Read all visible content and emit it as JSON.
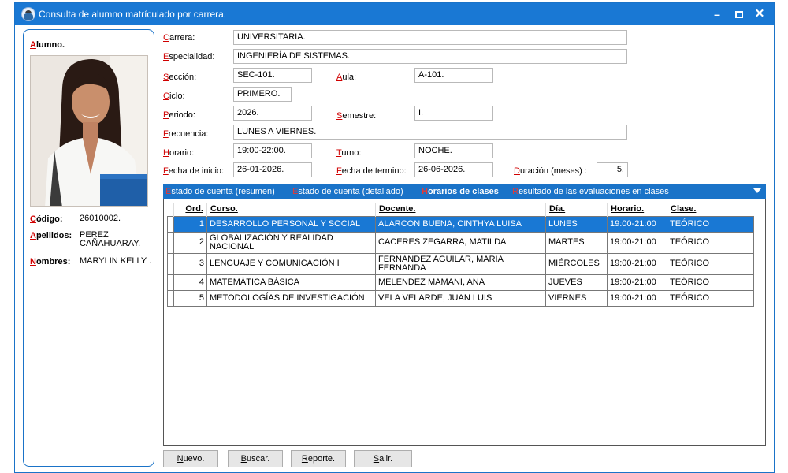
{
  "window": {
    "title": "Consulta de alumno matrículado por carrera.",
    "controls": {
      "minimize": "–",
      "close": "✕"
    }
  },
  "student": {
    "section_label": "Alumno.",
    "codigo_label": "Código:",
    "codigo": "26010002.",
    "apellidos_label": "Apellidos:",
    "apellidos": "PEREZ CAÑAHUARAY.",
    "nombres_label": "Nombres:",
    "nombres": "MARYLIN KELLY ."
  },
  "form": {
    "carrera": {
      "label": "Carrera:",
      "value": "UNIVERSITARIA."
    },
    "especialidad": {
      "label": "Especialidad:",
      "value": "INGENIERÍA DE SISTEMAS."
    },
    "seccion": {
      "label": "Sección:",
      "value": "SEC-101."
    },
    "aula": {
      "label": "Aula:",
      "value": "A-101."
    },
    "ciclo": {
      "label": "Ciclo:",
      "value": "PRIMERO."
    },
    "periodo": {
      "label": "Periodo:",
      "value": "2026."
    },
    "semestre": {
      "label": "Semestre:",
      "value": "I."
    },
    "frecuencia": {
      "label": "Frecuencia:",
      "value": "LUNES A VIERNES."
    },
    "horario": {
      "label": "Horario:",
      "value": "19:00-22:00."
    },
    "turno": {
      "label": "Turno:",
      "value": "NOCHE."
    },
    "fecha_inicio": {
      "label": "Fecha de inicio:",
      "value": "26-01-2026."
    },
    "fecha_termino": {
      "label": "Fecha de termino:",
      "value": "26-06-2026."
    },
    "duracion": {
      "label": "Duración (meses) :",
      "value": "5."
    }
  },
  "tabs": [
    {
      "hk": "E",
      "rest": "stado de cuenta (resumen)"
    },
    {
      "hk": "E",
      "rest": "stado de cuenta (detallado)"
    },
    {
      "hk": "H",
      "rest": "orarios de clases"
    },
    {
      "hk": "R",
      "rest": "esultado de las evaluaciones en clases"
    }
  ],
  "grid": {
    "columns": [
      "Ord.",
      "Curso.",
      "Docente.",
      "Día.",
      "Horario.",
      "Clase."
    ],
    "rows": [
      {
        "ord": "1",
        "curso": "DESARROLLO PERSONAL Y SOCIAL",
        "docente": "ALARCON BUENA, CINTHYA LUISA",
        "dia": "LUNES",
        "horario": "19:00-21:00",
        "clase": "TEÓRICO"
      },
      {
        "ord": "2",
        "curso": "GLOBALIZACIÓN Y REALIDAD NACIONAL",
        "docente": "CACERES ZEGARRA, MATILDA",
        "dia": "MARTES",
        "horario": "19:00-21:00",
        "clase": "TEÓRICO"
      },
      {
        "ord": "3",
        "curso": "LENGUAJE Y COMUNICACIÓN I",
        "docente": "FERNANDEZ AGUILAR, MARIA FERNANDA",
        "dia": "MIÉRCOLES",
        "horario": "19:00-21:00",
        "clase": "TEÓRICO"
      },
      {
        "ord": "4",
        "curso": "MATEMÁTICA BÁSICA",
        "docente": "MELENDEZ MAMANI, ANA",
        "dia": "JUEVES",
        "horario": "19:00-21:00",
        "clase": "TEÓRICO"
      },
      {
        "ord": "5",
        "curso": "METODOLOGÍAS DE INVESTIGACIÓN",
        "docente": "VELA VELARDE, JUAN LUIS",
        "dia": "VIERNES",
        "horario": "19:00-21:00",
        "clase": "TEÓRICO"
      }
    ]
  },
  "buttons": [
    {
      "hk": "N",
      "rest": "uevo."
    },
    {
      "hk": "B",
      "rest": "uscar."
    },
    {
      "hk": "R",
      "rest": "eporte."
    },
    {
      "hk": "S",
      "rest": "alir."
    }
  ],
  "colors": {
    "accent": "#1978d4",
    "hotkey": "#d00000",
    "selected_row": "#1978d4"
  }
}
